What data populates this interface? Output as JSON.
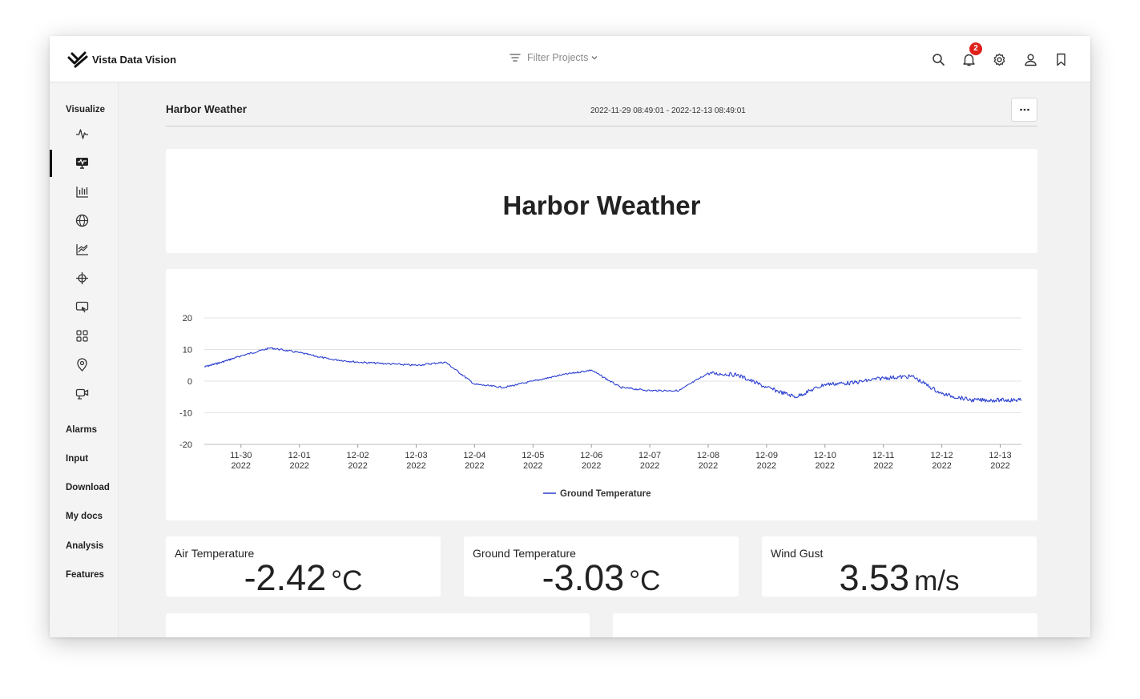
{
  "app": {
    "name": "Vista Data Vision"
  },
  "header": {
    "filter_label": "Filter Projects",
    "notification_count": "2",
    "icons": [
      "search-icon",
      "bell-icon",
      "gear-icon",
      "user-icon",
      "bookmark-icon"
    ]
  },
  "sidebar": {
    "heading": "Visualize",
    "icons": [
      "pulse-icon",
      "monitor-pulse-icon",
      "bar-chart-icon",
      "globe-icon",
      "line-chart-icon",
      "crosshair-icon",
      "screen-cursor-icon",
      "grid-icon",
      "location-pin-icon",
      "camera-icon"
    ],
    "links": [
      "Alarms",
      "Input",
      "Download",
      "My docs",
      "Analysis",
      "Features"
    ]
  },
  "page": {
    "title": "Harbor Weather",
    "date_range": "2022-11-29 08:49:01 - 2022-12-13 08:49:01",
    "heading": "Harbor Weather"
  },
  "chart_data": {
    "type": "line",
    "title": "",
    "xlabel": "",
    "ylabel": "",
    "x_ticks": [
      [
        "11-30",
        "2022"
      ],
      [
        "12-01",
        "2022"
      ],
      [
        "12-02",
        "2022"
      ],
      [
        "12-03",
        "2022"
      ],
      [
        "12-04",
        "2022"
      ],
      [
        "12-05",
        "2022"
      ],
      [
        "12-06",
        "2022"
      ],
      [
        "12-07",
        "2022"
      ],
      [
        "12-08",
        "2022"
      ],
      [
        "12-09",
        "2022"
      ],
      [
        "12-10",
        "2022"
      ],
      [
        "12-11",
        "2022"
      ],
      [
        "12-12",
        "2022"
      ],
      [
        "12-13",
        "2022"
      ]
    ],
    "y_ticks": [
      20,
      10,
      0,
      -10,
      -20
    ],
    "ylim": [
      -20,
      20
    ],
    "xlim": [
      "2022-11-29 08:49",
      "2022-12-13 08:49"
    ],
    "grid": true,
    "legend": "bottom",
    "color": "#2b3fd1",
    "series": [
      {
        "name": "Ground Temperature",
        "x": [
          "2022-11-29 08:49",
          "2022-11-29 16:00",
          "2022-11-30 00:00",
          "2022-11-30 12:00",
          "2022-12-01 00:00",
          "2022-12-01 12:00",
          "2022-12-02 00:00",
          "2022-12-02 12:00",
          "2022-12-03 00:00",
          "2022-12-03 12:00",
          "2022-12-04 00:00",
          "2022-12-04 12:00",
          "2022-12-05 00:00",
          "2022-12-05 12:00",
          "2022-12-06 00:00",
          "2022-12-06 12:00",
          "2022-12-07 00:00",
          "2022-12-07 12:00",
          "2022-12-08 00:00",
          "2022-12-08 12:00",
          "2022-12-09 00:00",
          "2022-12-09 12:00",
          "2022-12-10 00:00",
          "2022-12-10 12:00",
          "2022-12-11 00:00",
          "2022-12-11 12:00",
          "2022-12-12 00:00",
          "2022-12-12 12:00",
          "2022-12-13 00:00",
          "2022-12-13 08:49"
        ],
        "y": [
          4.5,
          6,
          8,
          10.5,
          9,
          7,
          6,
          5.5,
          5,
          6,
          -1,
          -2,
          0,
          2,
          3.5,
          -2,
          -3,
          -3,
          2.5,
          2,
          -2,
          -5,
          -1,
          -0.5,
          1,
          1.5,
          -4,
          -6,
          -6,
          -6
        ]
      }
    ]
  },
  "metrics": [
    {
      "label": "Air Temperature",
      "value": "-2.42",
      "unit": "°C"
    },
    {
      "label": "Ground Temperature",
      "value": "-3.03",
      "unit": "°C"
    },
    {
      "label": "Wind Gust",
      "value": "3.53",
      "unit": "m/s"
    }
  ]
}
